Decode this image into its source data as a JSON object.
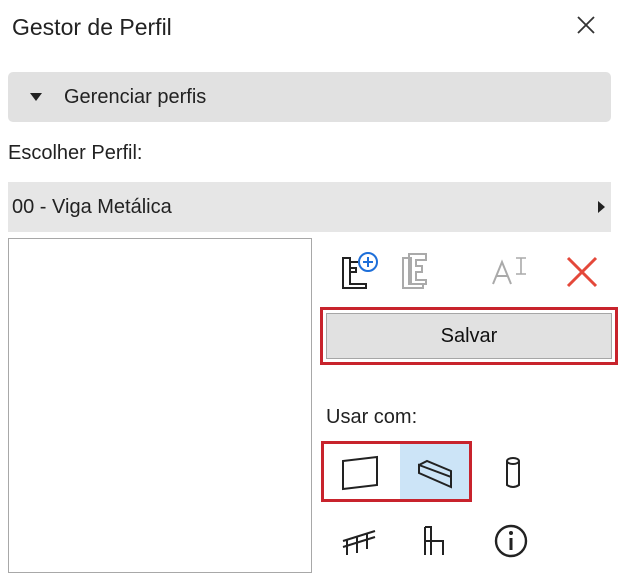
{
  "window": {
    "title": "Gestor de Perfil",
    "close_icon": "close-icon"
  },
  "manage_section": {
    "label": "Gerenciar perfis",
    "expanded": true
  },
  "profile": {
    "choose_label": "Escolher Perfil:",
    "selected": "00 - Viga Metálica"
  },
  "toolbar": {
    "icons": [
      "new-profile-icon",
      "duplicate-profile-icon",
      "rename-profile-icon",
      "delete-profile-icon"
    ],
    "delete_color": "#e4483a",
    "save_label": "Salvar"
  },
  "use_with": {
    "label": "Usar com:",
    "elements": [
      "wall-icon",
      "beam-icon",
      "column-icon",
      "railing-icon",
      "chair-icon",
      "info-icon"
    ],
    "selected_element": "beam-icon",
    "selected_bg": "#cce4f7"
  },
  "highlight_color": "#c8232c"
}
